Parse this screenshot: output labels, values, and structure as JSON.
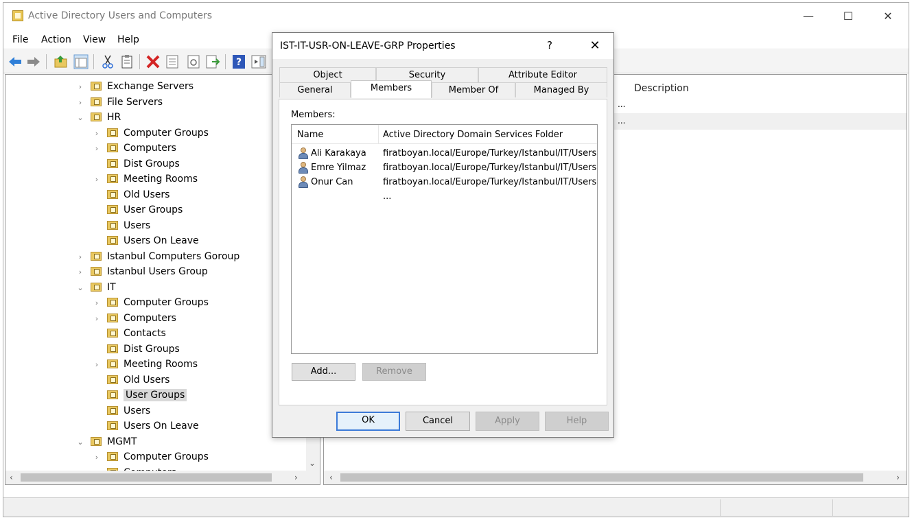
{
  "window": {
    "title": "Active Directory Users and Computers",
    "minimize": "—",
    "maximize": "☐",
    "close": "✕"
  },
  "menu": [
    "File",
    "Action",
    "View",
    "Help"
  ],
  "tree": {
    "items": [
      {
        "label": "Exchange Servers",
        "expander": "›"
      },
      {
        "label": "File Servers",
        "expander": "›"
      },
      {
        "label": "HR",
        "expander": "⌄"
      },
      {
        "label": "Computer Groups",
        "expander": "›"
      },
      {
        "label": "Computers",
        "expander": "›"
      },
      {
        "label": "Dist Groups",
        "expander": ""
      },
      {
        "label": "Meeting Rooms",
        "expander": "›"
      },
      {
        "label": "Old Users",
        "expander": ""
      },
      {
        "label": "User Groups",
        "expander": ""
      },
      {
        "label": "Users",
        "expander": ""
      },
      {
        "label": "Users On Leave",
        "expander": ""
      },
      {
        "label": "Istanbul Computers Gorоup",
        "expander": "›"
      },
      {
        "label": "Istanbul Users Group",
        "expander": "›"
      },
      {
        "label": "IT",
        "expander": "⌄"
      },
      {
        "label": "Computer Groups",
        "expander": "›"
      },
      {
        "label": "Computers",
        "expander": "›"
      },
      {
        "label": "Contacts",
        "expander": ""
      },
      {
        "label": "Dist Groups",
        "expander": ""
      },
      {
        "label": "Meeting Rooms",
        "expander": "›"
      },
      {
        "label": "Old Users",
        "expander": ""
      },
      {
        "label": "User Groups",
        "expander": ""
      },
      {
        "label": "Users",
        "expander": ""
      },
      {
        "label": "Users On Leave",
        "expander": ""
      },
      {
        "label": "MGMT",
        "expander": "⌄"
      },
      {
        "label": "Computer Groups",
        "expander": "›"
      },
      {
        "label": "Computers",
        "expander": "›"
      }
    ]
  },
  "list": {
    "column_description": "Description",
    "ellipsis": "..."
  },
  "dialog": {
    "title": "IST-IT-USR-ON-LEAVE-GRP Properties",
    "help": "?",
    "close": "✕",
    "tabs_back": [
      "Object",
      "Security",
      "Attribute Editor"
    ],
    "tabs_front": [
      "General",
      "Members",
      "Member Of",
      "Managed By"
    ],
    "members_label": "Members:",
    "columns": [
      "Name",
      "Active Directory Domain Services Folder"
    ],
    "members": [
      {
        "name": "Ali Karakaya",
        "folder": "firatboyan.local/Europe/Turkey/Istanbul/IT/Users ..."
      },
      {
        "name": "Emre Yilmaz",
        "folder": "firatboyan.local/Europe/Turkey/Istanbul/IT/Users ..."
      },
      {
        "name": "Onur Can",
        "folder": "firatboyan.local/Europe/Turkey/Istanbul/IT/Users ..."
      }
    ],
    "add": "Add...",
    "remove": "Remove",
    "ok": "OK",
    "cancel": "Cancel",
    "apply": "Apply",
    "help_btn": "Help"
  }
}
